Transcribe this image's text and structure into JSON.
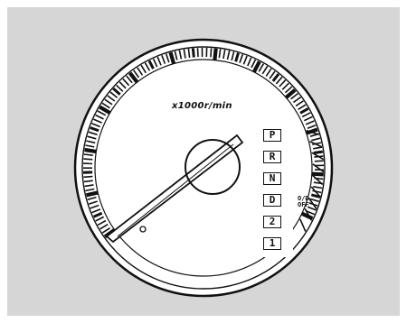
{
  "panel": {
    "background_color": "#d6d6d6",
    "ink_color": "#111111"
  },
  "tachometer": {
    "unit_label": "x1000r/min",
    "needle_level": 0.0
  },
  "shift_indicator": {
    "gears": [
      "P",
      "R",
      "N",
      "D",
      "2",
      "1"
    ],
    "od_off_line1": "O/D",
    "od_off_line2": "OFF"
  }
}
